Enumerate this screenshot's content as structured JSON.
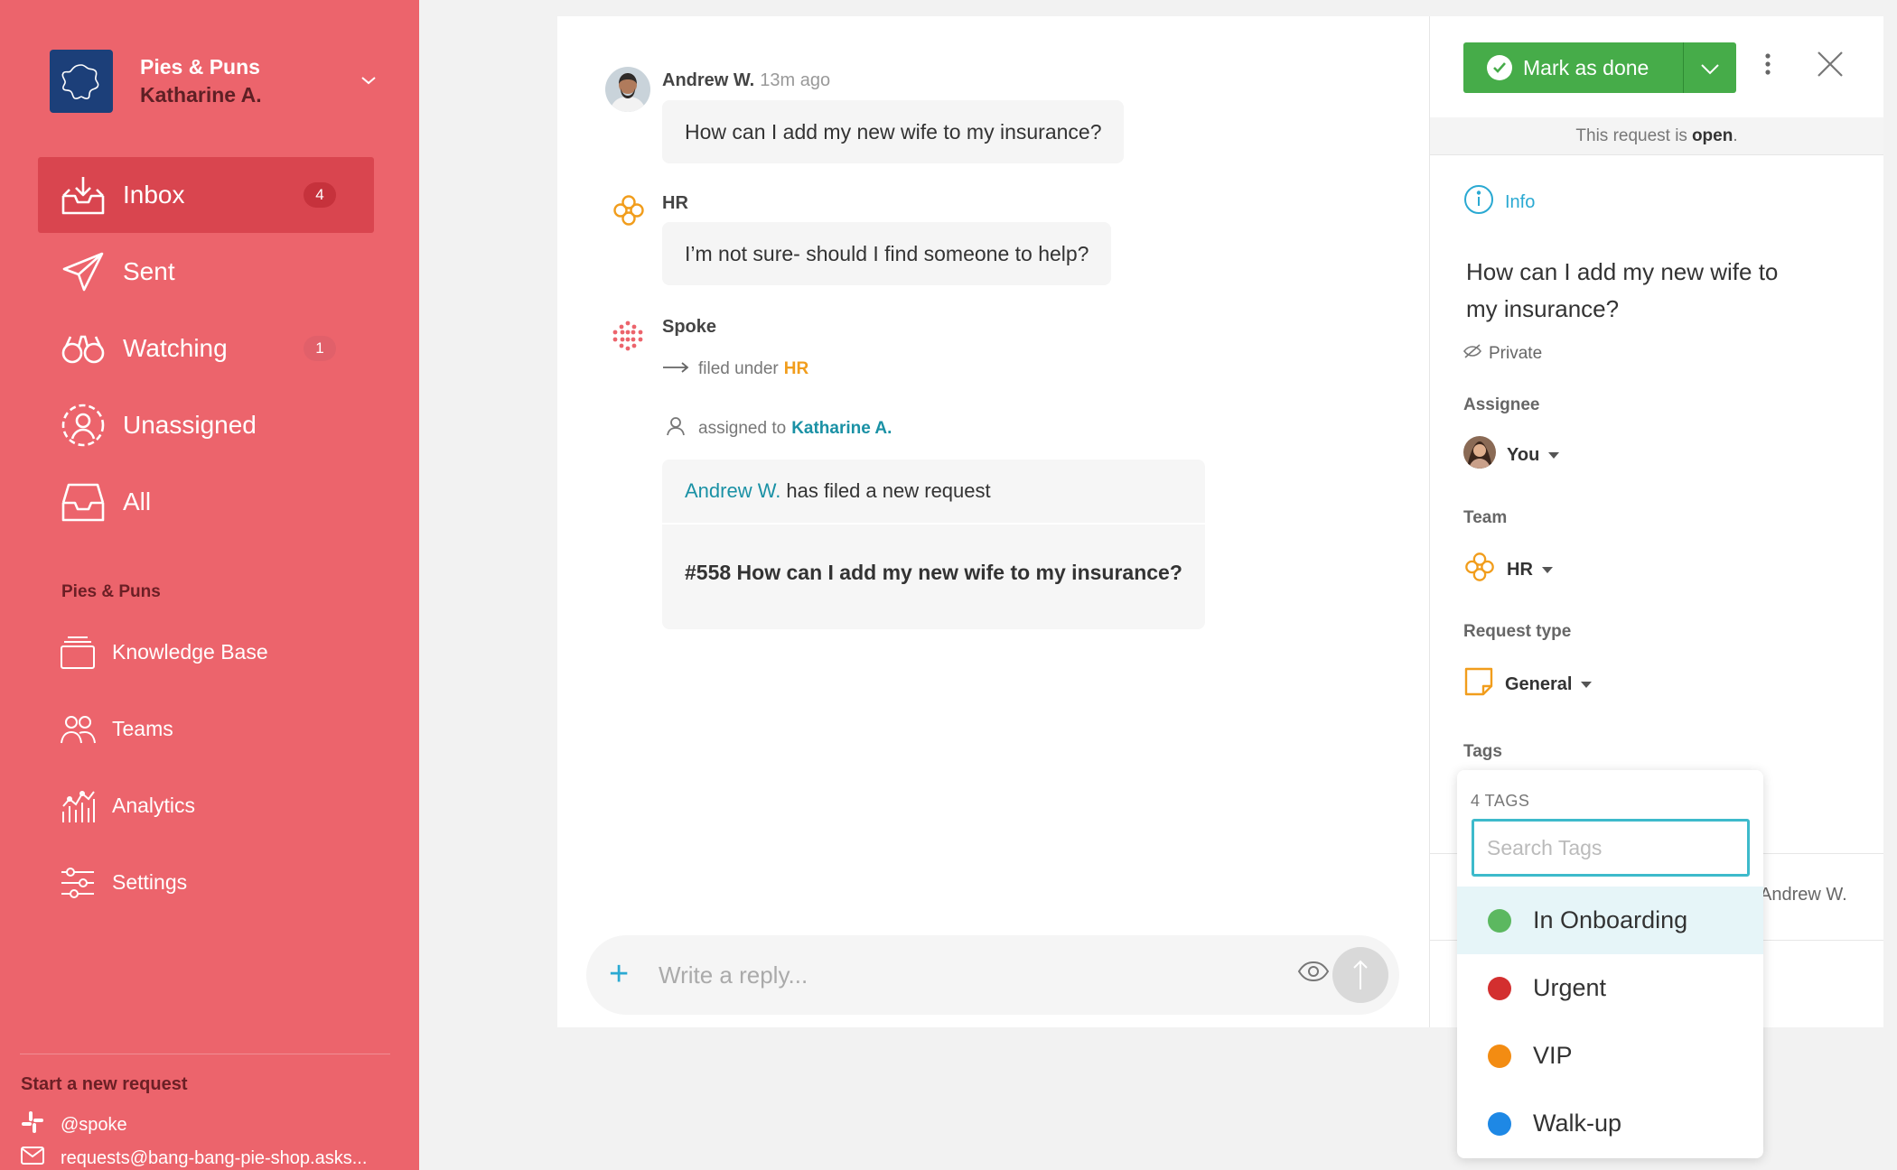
{
  "sidebar": {
    "org_name": "Pies & Puns",
    "org_user": "Katharine A.",
    "nav": [
      {
        "label": "Inbox",
        "badge": "4"
      },
      {
        "label": "Sent",
        "badge": ""
      },
      {
        "label": "Watching",
        "badge": "1"
      },
      {
        "label": "Unassigned",
        "badge": ""
      },
      {
        "label": "All",
        "badge": ""
      }
    ],
    "section_title": "Pies & Puns",
    "secondary": [
      {
        "label": "Knowledge Base"
      },
      {
        "label": "Teams"
      },
      {
        "label": "Analytics"
      },
      {
        "label": "Settings"
      }
    ],
    "new_request_title": "Start a new request",
    "slack_handle": "@spoke",
    "email": "requests@bang-bang-pie-shop.asks..."
  },
  "conversation": {
    "msg1": {
      "author": "Andrew W.",
      "time": "13m ago",
      "text": "How can I add my new wife to my insurance?"
    },
    "msg2": {
      "author": "HR",
      "text": "I’m not sure- should I find someone to help?"
    },
    "spoke": {
      "author": "Spoke",
      "filed_prefix": "filed under",
      "filed_team": "HR",
      "assigned_prefix": "assigned to",
      "assigned_user": "Katharine A."
    },
    "card": {
      "requester": "Andrew W.",
      "action": "has filed a new request",
      "title": "#558 How can I add my new wife to my insurance?"
    },
    "composer": {
      "placeholder": "Write a reply..."
    }
  },
  "panel": {
    "mark_done_label": "Mark as done",
    "status_prefix": "This request is",
    "status_value": "open",
    "status_suffix": ".",
    "info_tab": "Info",
    "request_title": "How can I add my new wife to my insurance?",
    "privacy": "Private",
    "assignee_label": "Assignee",
    "assignee_value": "You",
    "team_label": "Team",
    "team_value": "HR",
    "request_type_label": "Request type",
    "request_type_value": "General",
    "tags_label": "Tags",
    "behind_text": "Andrew W."
  },
  "tags_dropdown": {
    "count": "4 TAGS",
    "search_placeholder": "Search Tags",
    "items": [
      {
        "label": "In Onboarding",
        "color": "#5cb860"
      },
      {
        "label": "Urgent",
        "color": "#d32f2f"
      },
      {
        "label": "VIP",
        "color": "#f38c12"
      },
      {
        "label": "Walk-up",
        "color": "#1e88e5"
      }
    ]
  },
  "colors": {
    "sidebar": "#ec646c",
    "sidebar_active": "#d9454f",
    "accent_teal": "#1a91a5",
    "mark_done_green": "#46ac49"
  }
}
